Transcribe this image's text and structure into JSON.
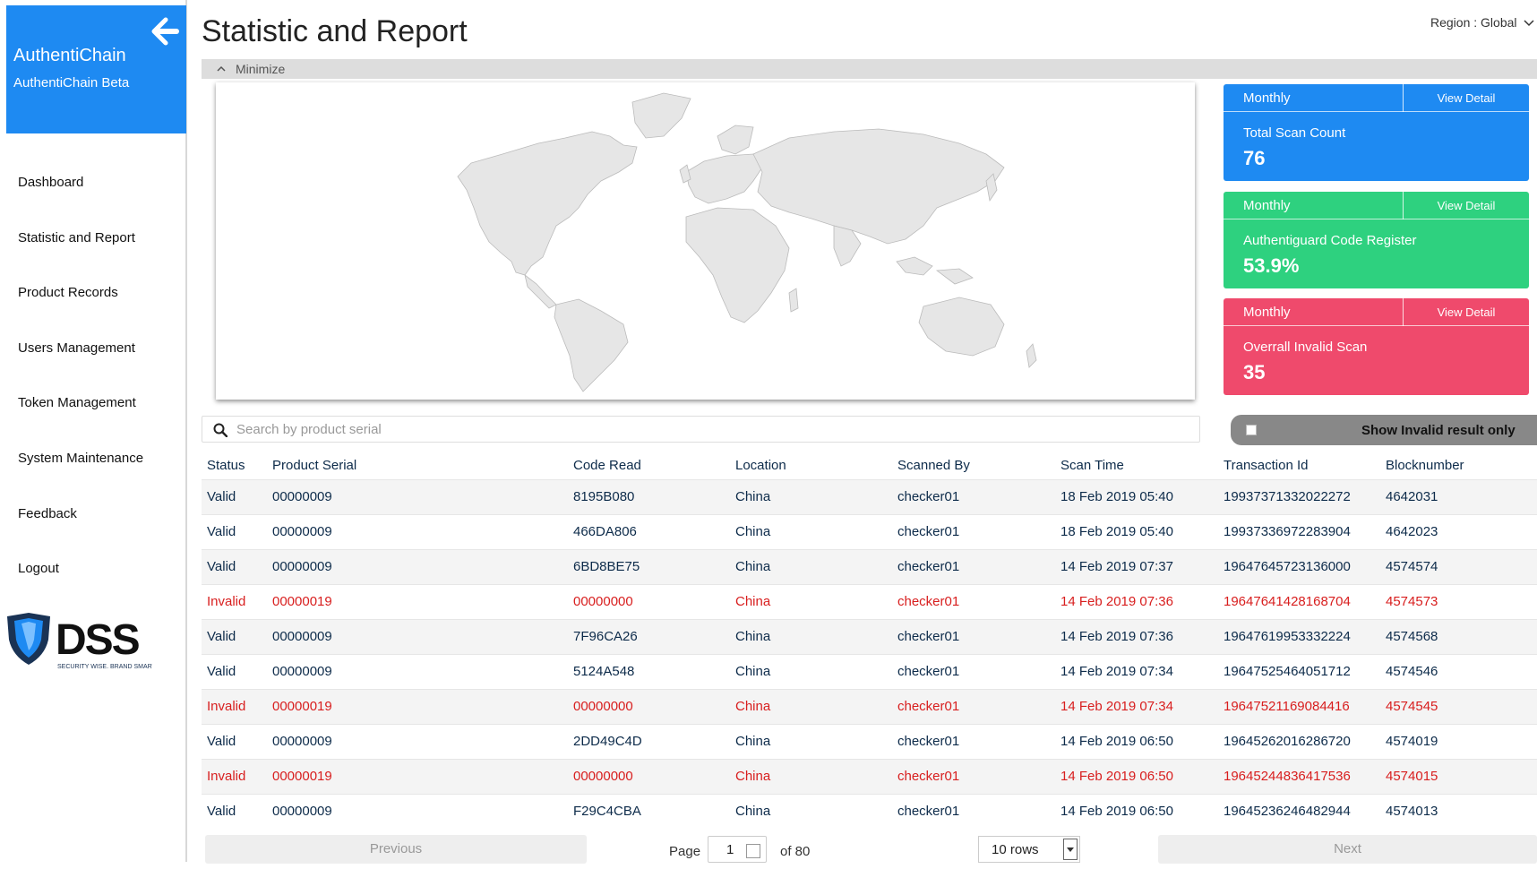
{
  "sidebar": {
    "brand_title": "AuthentiChain",
    "brand_sub": "AuthentiChain Beta",
    "items": [
      {
        "label": "Dashboard"
      },
      {
        "label": "Statistic and Report"
      },
      {
        "label": "Product Records"
      },
      {
        "label": "Users Management"
      },
      {
        "label": "Token Management"
      },
      {
        "label": "System Maintenance"
      },
      {
        "label": "Feedback"
      },
      {
        "label": "Logout"
      }
    ],
    "logo_text": "DSS",
    "logo_tagline": "SECURITY WISE. BRAND SMART."
  },
  "header": {
    "title": "Statistic and Report",
    "region": "Region : Global",
    "minimize": "Minimize"
  },
  "cards": [
    {
      "period": "Monthly",
      "detail": "View Detail",
      "label": "Total Scan Count",
      "value": "76",
      "color": "#1e8af2"
    },
    {
      "period": "Monthly",
      "detail": "View Detail",
      "label": "Authentiguard Code Register",
      "value": "53.9%",
      "color": "#2ed17f"
    },
    {
      "period": "Monthly",
      "detail": "View Detail",
      "label": "Overrall Invalid Scan",
      "value": "35",
      "color": "#ef4a6c"
    }
  ],
  "search": {
    "placeholder": "Search by product serial"
  },
  "filter": {
    "label": "Show Invalid result only"
  },
  "table": {
    "columns": [
      "Status",
      "Product Serial",
      "Code Read",
      "Location",
      "Scanned By",
      "Scan Time",
      "Transaction Id",
      "Blocknumber"
    ],
    "rows": [
      [
        "Valid",
        "00000009",
        "8195B080",
        "China",
        "checker01",
        "18 Feb 2019 05:40",
        "19937371332022272",
        "4642031"
      ],
      [
        "Valid",
        "00000009",
        "466DA806",
        "China",
        "checker01",
        "18 Feb 2019 05:40",
        "19937336972283904",
        "4642023"
      ],
      [
        "Valid",
        "00000009",
        "6BD8BE75",
        "China",
        "checker01",
        "14 Feb 2019 07:37",
        "19647645723136000",
        "4574574"
      ],
      [
        "Invalid",
        "00000019",
        "00000000",
        "China",
        "checker01",
        "14 Feb 2019 07:36",
        "19647641428168704",
        "4574573"
      ],
      [
        "Valid",
        "00000009",
        "7F96CA26",
        "China",
        "checker01",
        "14 Feb 2019 07:36",
        "19647619953332224",
        "4574568"
      ],
      [
        "Valid",
        "00000009",
        "5124A548",
        "China",
        "checker01",
        "14 Feb 2019 07:34",
        "19647525464051712",
        "4574546"
      ],
      [
        "Invalid",
        "00000019",
        "00000000",
        "China",
        "checker01",
        "14 Feb 2019 07:34",
        "19647521169084416",
        "4574545"
      ],
      [
        "Valid",
        "00000009",
        "2DD49C4D",
        "China",
        "checker01",
        "14 Feb 2019 06:50",
        "19645262016286720",
        "4574019"
      ],
      [
        "Invalid",
        "00000019",
        "00000000",
        "China",
        "checker01",
        "14 Feb 2019 06:50",
        "19645244836417536",
        "4574015"
      ],
      [
        "Valid",
        "00000009",
        "F29C4CBA",
        "China",
        "checker01",
        "14 Feb 2019 06:50",
        "19645236246482944",
        "4574013"
      ]
    ]
  },
  "pager": {
    "previous": "Previous",
    "page_label": "Page",
    "page": "1",
    "of": "of 80",
    "rows": "10 rows",
    "next": "Next"
  },
  "colors": {
    "brand": "#1e8af2",
    "invalid": "#d81e1e",
    "text": "#0d2b4a"
  }
}
